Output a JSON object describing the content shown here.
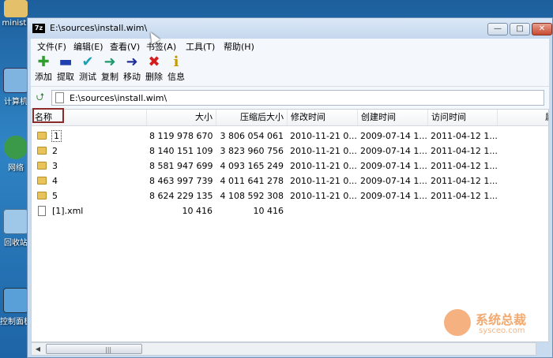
{
  "desktop": {
    "icons": [
      {
        "label": "ministr",
        "top": 0
      },
      {
        "label": "计算机",
        "top": 0
      },
      {
        "label": "网络",
        "top": 0
      },
      {
        "label": "回收站",
        "top": 0
      },
      {
        "label": "控制面板",
        "top": 0
      }
    ]
  },
  "window": {
    "title": "E:\\sources\\install.wim\\",
    "app_icon_text": "7z",
    "controls": {
      "minimize": "—",
      "maximize": "□",
      "close": "✕"
    }
  },
  "menu": [
    "文件(F)",
    "编辑(E)",
    "查看(V)",
    "书签(A)",
    "工具(T)",
    "帮助(H)"
  ],
  "toolbar": [
    {
      "label": "添加",
      "icon": "plus-icon",
      "glyph": "✚",
      "color": "#2f9e2f"
    },
    {
      "label": "提取",
      "icon": "minus-icon",
      "glyph": "▬",
      "color": "#1f3fb0"
    },
    {
      "label": "测试",
      "icon": "check-icon",
      "glyph": "✔",
      "color": "#1ca0b8"
    },
    {
      "label": "复制",
      "icon": "arrow-right-icon",
      "glyph": "➜",
      "color": "#1a9a6a"
    },
    {
      "label": "移动",
      "icon": "arrow-move-icon",
      "glyph": "➜",
      "color": "#1f2f9a"
    },
    {
      "label": "删除",
      "icon": "delete-icon",
      "glyph": "✖",
      "color": "#d41e1e"
    },
    {
      "label": "信息",
      "icon": "info-icon",
      "glyph": "i",
      "color": "#c79a00"
    }
  ],
  "address": {
    "path": "E:\\sources\\install.wim\\"
  },
  "columns": [
    "名称",
    "大小",
    "压缩后大小",
    "修改时间",
    "创建时间",
    "访问时间",
    "属"
  ],
  "rows": [
    {
      "name": "1",
      "type": "folder",
      "size": "8 119 978 670",
      "packed": "3 806 054 061",
      "modified": "2010-11-21 0...",
      "created": "2009-07-14 1...",
      "accessed": "2011-04-12 1..."
    },
    {
      "name": "2",
      "type": "folder",
      "size": "8 140 151 109",
      "packed": "3 823 960 756",
      "modified": "2010-11-21 0...",
      "created": "2009-07-14 1...",
      "accessed": "2011-04-12 1..."
    },
    {
      "name": "3",
      "type": "folder",
      "size": "8 581 947 699",
      "packed": "4 093 165 249",
      "modified": "2010-11-21 0...",
      "created": "2009-07-14 1...",
      "accessed": "2011-04-12 1..."
    },
    {
      "name": "4",
      "type": "folder",
      "size": "8 463 997 739",
      "packed": "4 011 641 278",
      "modified": "2010-11-21 0...",
      "created": "2009-07-14 1...",
      "accessed": "2011-04-12 1..."
    },
    {
      "name": "5",
      "type": "folder",
      "size": "8 624 229 135",
      "packed": "4 108 592 308",
      "modified": "2010-11-21 0...",
      "created": "2009-07-14 1...",
      "accessed": "2011-04-12 1..."
    },
    {
      "name": "[1].xml",
      "type": "file",
      "size": "10 416",
      "packed": "10 416",
      "modified": "",
      "created": "",
      "accessed": ""
    }
  ],
  "watermark": {
    "text": "系统总裁",
    "sub": "sysceo.com"
  },
  "colors": {
    "highlight_border": "#8b2a2a",
    "title_bg": "#c5d8ee"
  }
}
